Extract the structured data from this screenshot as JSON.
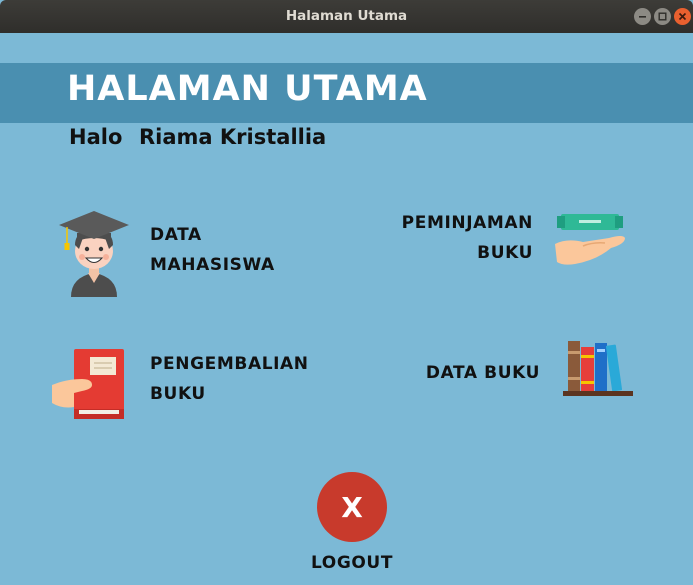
{
  "window": {
    "title": "Halaman Utama"
  },
  "header": {
    "title": "HALAMAN UTAMA"
  },
  "greeting": {
    "prefix": "Halo",
    "name": "Riama Kristallia"
  },
  "menu": {
    "data_mahasiswa": {
      "line1": "DATA",
      "line2": "MAHASISWA",
      "icon": "student-graduate-icon"
    },
    "peminjaman_buku": {
      "line1": "PEMINJAMAN",
      "line2": "BUKU",
      "icon": "hand-giving-book-icon"
    },
    "pengembalian_buku": {
      "line1": "PENGEMBALIAN",
      "line2": "BUKU",
      "icon": "hand-returning-book-icon"
    },
    "data_buku": {
      "line1": "DATA BUKU",
      "icon": "bookshelf-icon"
    }
  },
  "logout": {
    "symbol": "X",
    "label": "LOGOUT"
  },
  "colors": {
    "background": "#7cb9d6",
    "banner": "#4a8fb0",
    "logout": "#c83a2c"
  }
}
